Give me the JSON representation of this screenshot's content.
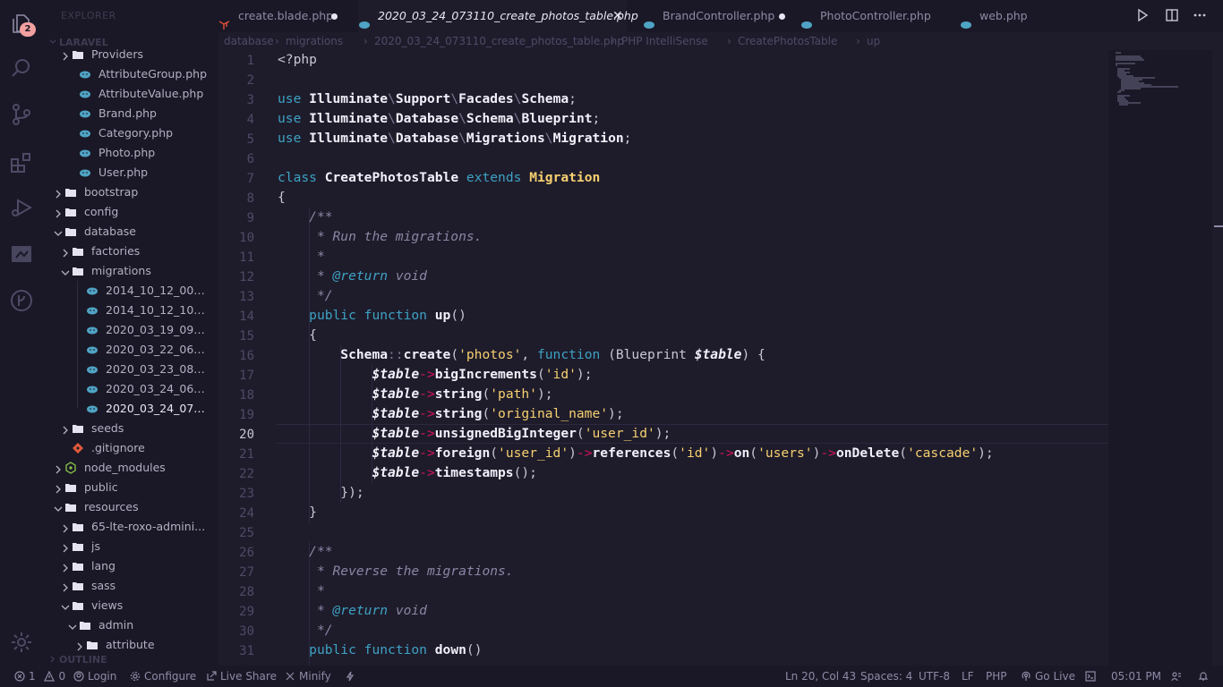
{
  "activity": {
    "badge_count": "2"
  },
  "sidebar": {
    "title": "EXPLORER",
    "section_root": "LARAVEL",
    "section_outline": "OUTLINE",
    "items": [
      {
        "label": "Providers",
        "type": "folder",
        "depth": 2,
        "state": "collapsed"
      },
      {
        "label": "AttributeGroup.php",
        "type": "php",
        "depth": 3
      },
      {
        "label": "AttributeValue.php",
        "type": "php",
        "depth": 3
      },
      {
        "label": "Brand.php",
        "type": "php",
        "depth": 3
      },
      {
        "label": "Category.php",
        "type": "php",
        "depth": 3
      },
      {
        "label": "Photo.php",
        "type": "php",
        "depth": 3
      },
      {
        "label": "User.php",
        "type": "php",
        "depth": 3
      },
      {
        "label": "bootstrap",
        "type": "folder",
        "depth": 1,
        "state": "collapsed"
      },
      {
        "label": "config",
        "type": "folder",
        "depth": 1,
        "state": "collapsed"
      },
      {
        "label": "database",
        "type": "folder",
        "depth": 1,
        "state": "expanded"
      },
      {
        "label": "factories",
        "type": "folder",
        "depth": 2,
        "state": "collapsed"
      },
      {
        "label": "migrations",
        "type": "folder",
        "depth": 2,
        "state": "expanded"
      },
      {
        "label": "2014_10_12_0000...",
        "type": "php",
        "depth": 4
      },
      {
        "label": "2014_10_12_1000...",
        "type": "php",
        "depth": 4
      },
      {
        "label": "2020_03_19_0935...",
        "type": "php",
        "depth": 4
      },
      {
        "label": "2020_03_22_0624...",
        "type": "php",
        "depth": 4
      },
      {
        "label": "2020_03_23_0852...",
        "type": "php",
        "depth": 4
      },
      {
        "label": "2020_03_24_0648...",
        "type": "php",
        "depth": 4
      },
      {
        "label": "2020_03_24_0731...",
        "type": "php",
        "depth": 4,
        "selected": true
      },
      {
        "label": "seeds",
        "type": "folder",
        "depth": 2,
        "state": "collapsed"
      },
      {
        "label": ".gitignore",
        "type": "git",
        "depth": 2
      },
      {
        "label": "node_modules",
        "type": "node",
        "depth": 1,
        "state": "collapsed"
      },
      {
        "label": "public",
        "type": "folder",
        "depth": 1,
        "state": "collapsed"
      },
      {
        "label": "resources",
        "type": "folder",
        "depth": 1,
        "state": "expanded"
      },
      {
        "label": "65-lte-roxo-admini...",
        "type": "folder",
        "depth": 2,
        "state": "collapsed"
      },
      {
        "label": "js",
        "type": "folder",
        "depth": 2,
        "state": "collapsed"
      },
      {
        "label": "lang",
        "type": "folder",
        "depth": 2,
        "state": "collapsed"
      },
      {
        "label": "sass",
        "type": "folder",
        "depth": 2,
        "state": "collapsed"
      },
      {
        "label": "views",
        "type": "folder",
        "depth": 2,
        "state": "expanded"
      },
      {
        "label": "admin",
        "type": "folder",
        "depth": 3,
        "state": "expanded"
      },
      {
        "label": "attribute",
        "type": "folder",
        "depth": 4,
        "state": "collapsed"
      }
    ]
  },
  "tabs": [
    {
      "label": "create.blade.php",
      "icon": "laravel",
      "dirty": true
    },
    {
      "label": "2020_03_24_073110_create_photos_table.php",
      "icon": "php",
      "active": true
    },
    {
      "label": "BrandController.php",
      "icon": "php",
      "dirty": true
    },
    {
      "label": "PhotoController.php",
      "icon": "php"
    },
    {
      "label": "web.php",
      "icon": "php"
    }
  ],
  "breadcrumbs": [
    "database",
    "migrations",
    "2020_03_24_073110_create_photos_table.php",
    "PHP IntelliSense",
    "CreatePhotosTable",
    "up"
  ],
  "editor": {
    "current_line": 20,
    "line_numbers": [
      "1",
      "2",
      "3",
      "4",
      "5",
      "6",
      "7",
      "8",
      "9",
      "10",
      "11",
      "12",
      "13",
      "14",
      "15",
      "16",
      "17",
      "18",
      "19",
      "20",
      "21",
      "22",
      "23",
      "24",
      "25",
      "26",
      "27",
      "28",
      "29",
      "30",
      "31"
    ],
    "code": [
      "<?php",
      "",
      "use Illuminate\\Support\\Facades\\Schema;",
      "use Illuminate\\Database\\Schema\\Blueprint;",
      "use Illuminate\\Database\\Migrations\\Migration;",
      "",
      "class CreatePhotosTable extends Migration",
      "{",
      "    /**",
      "     * Run the migrations.",
      "     *",
      "     * @return void",
      "     */",
      "    public function up()",
      "    {",
      "        Schema::create('photos', function (Blueprint $table) {",
      "            $table->bigIncrements('id');",
      "            $table->string('path');",
      "            $table->string('original_name');",
      "            $table->unsignedBigInteger('user_id');",
      "            $table->foreign('user_id')->references('id')->on('users')->onDelete('cascade');",
      "            $table->timestamps();",
      "        });",
      "    }",
      "",
      "    /**",
      "     * Reverse the migrations.",
      "     *",
      "     * @return void",
      "     */",
      "    public function down()"
    ]
  },
  "status": {
    "errors": "1",
    "warnings": "0",
    "login": "Login",
    "configure": "Configure",
    "live_share": "Live Share",
    "minify": "Minify",
    "position": "Ln 20, Col 43",
    "spaces": "Spaces: 4",
    "encoding": "UTF-8",
    "eol": "LF",
    "language": "PHP",
    "go_live": "Go Live",
    "time": "05:01 PM"
  },
  "colors": {
    "background": "#1e1c2b",
    "sidebar": "#1a1826",
    "keyword": "#3ea2c4",
    "string": "#f7d070",
    "arrow": "#d4145a",
    "comment": "#8a86a4"
  }
}
